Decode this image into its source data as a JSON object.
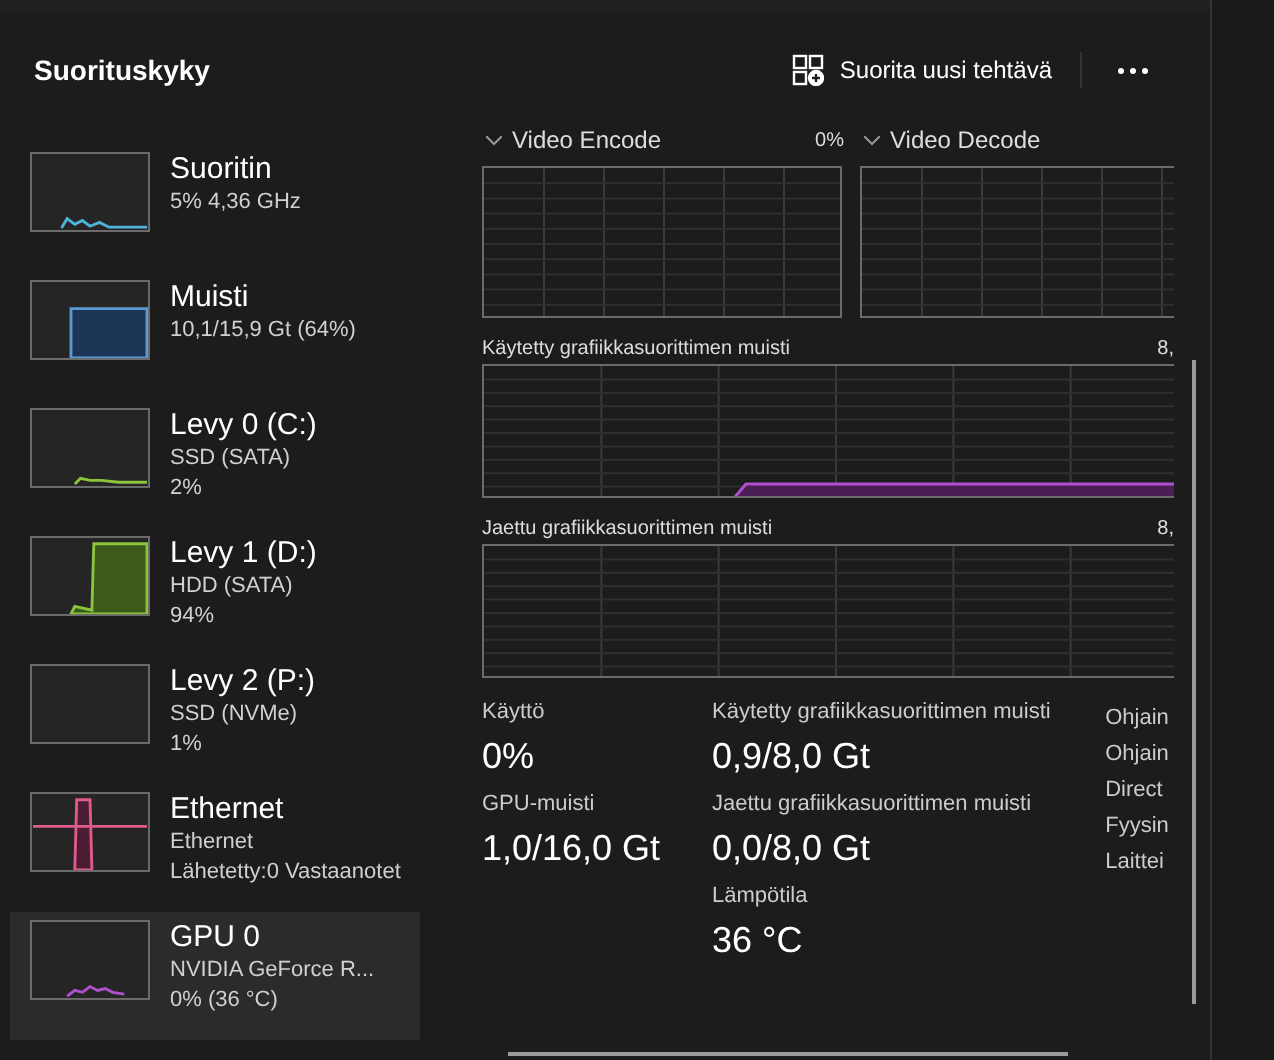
{
  "header": {
    "title": "Suorituskyky",
    "run_task_button": "Suorita uusi tehtävä"
  },
  "sidebar": {
    "items": [
      {
        "kind": "cpu",
        "color": "#4fb3d9",
        "title": "Suoritin",
        "lines": [
          "5%  4,36 GHz"
        ],
        "selected": false
      },
      {
        "kind": "memory",
        "color": "#5b9bd5",
        "title": "Muisti",
        "lines": [
          "10,1/15,9 Gt (64%)"
        ],
        "selected": false
      },
      {
        "kind": "disk-low",
        "color": "#8cc43f",
        "title": "Levy 0 (C:)",
        "lines": [
          "SSD (SATA)",
          "2%"
        ],
        "selected": false
      },
      {
        "kind": "disk-high",
        "color": "#8cc43f",
        "title": "Levy 1 (D:)",
        "lines": [
          "HDD (SATA)",
          "94%"
        ],
        "selected": false
      },
      {
        "kind": "empty",
        "title": "Levy 2 (P:)",
        "lines": [
          "SSD (NVMe)",
          "1%"
        ],
        "selected": false
      },
      {
        "kind": "network",
        "color": "#e05a8c",
        "title": "Ethernet",
        "lines": [
          "Ethernet",
          "Lähetetty:0 Vastaanotet"
        ],
        "selected": false
      },
      {
        "kind": "gpu",
        "color": "#b04fd0",
        "title": "GPU 0",
        "lines": [
          "NVIDIA GeForce R...",
          "0%  (36 °C)"
        ],
        "selected": true
      }
    ]
  },
  "engines": [
    {
      "label": "Video Encode",
      "value": "0%"
    },
    {
      "label": "Video Decode"
    }
  ],
  "memory_graphs": [
    {
      "label": "Käytetty grafiikkasuorittimen muisti",
      "max": "8,",
      "kind": "used"
    },
    {
      "label": "Jaettu grafiikkasuorittimen muisti",
      "max": "8,",
      "kind": "empty"
    }
  ],
  "stats": [
    [
      {
        "label": "Käyttö",
        "value": "0%"
      },
      {
        "label": "GPU-muisti",
        "value": "1,0/16,0 Gt"
      }
    ],
    [
      {
        "label": "Käytetty grafiikkasuorittimen muisti",
        "value": "0,9/8,0 Gt"
      },
      {
        "label": "Jaettu grafiikkasuorittimen muisti",
        "value": "0,0/8,0 Gt"
      },
      {
        "label": "Lämpötila",
        "value": "36 °C"
      }
    ]
  ],
  "properties": [
    "Ohjain",
    "Ohjain",
    "Direct",
    "Fyysin",
    "Laittei"
  ]
}
